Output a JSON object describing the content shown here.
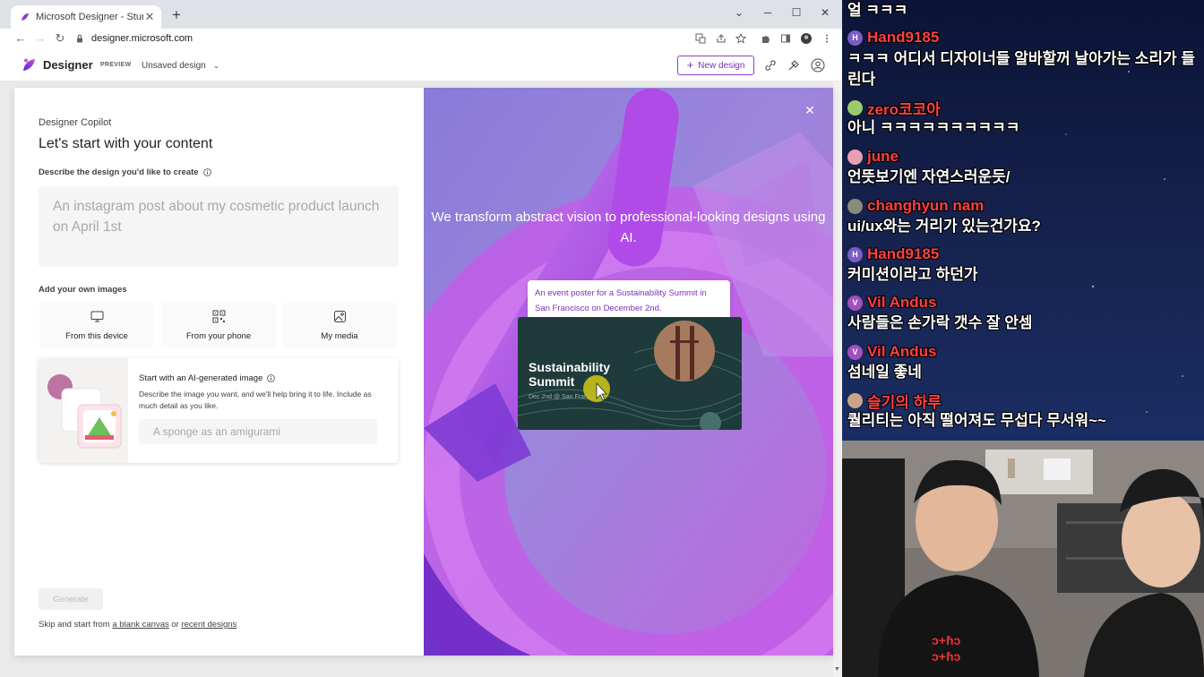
{
  "browser": {
    "tab_title": "Microsoft Designer - Stunning d",
    "tab_close": "✕",
    "new_tab": "+",
    "url": "designer.microsoft.com",
    "win_min": "─",
    "win_max": "☐",
    "win_close": "✕",
    "win_dropdown": "⌄"
  },
  "app": {
    "brand": "Designer",
    "badge": "PREVIEW",
    "doc_name": "Unsaved design",
    "new_design": "New design",
    "accent": "#7b2fb7"
  },
  "copilot": {
    "label": "Designer Copilot",
    "title": "Let's start with your content",
    "describe_label": "Describe the design you'd like to create",
    "prompt_placeholder": "An instagram post about my cosmetic product launch on April 1st",
    "images_label": "Add your own images",
    "sources": [
      "From this device",
      "From your phone",
      "My media"
    ],
    "ai_title": "Start with an AI-generated image",
    "ai_desc": "Describe the image you want, and we'll help bring it to life. Include as much detail as you like.",
    "ai_placeholder": "A sponge as an amigurami",
    "generate": "Generate",
    "skip_prefix": "Skip and start from",
    "blank_canvas": "a blank canvas",
    "or": "or",
    "recent_designs": "recent designs"
  },
  "showcase": {
    "close": "✕",
    "hero": "We transform abstract vision to professional-looking designs using AI.",
    "bubble": "An event poster for a Sustainability Summit in San Francisco on December 2nd.",
    "poster_title": "Sustainability Summit",
    "poster_sub": "Dec 2nd @ San Francisco"
  },
  "chat": {
    "messages": [
      {
        "user": "",
        "text": "얼 ㅋㅋㅋ",
        "avatar": "",
        "avatar_color": ""
      },
      {
        "user": "Hand9185",
        "text": "ㅋㅋㅋ 어디서 디자이너들 알바할꺼 날아가는 소리가 들린다",
        "avatar": "H",
        "avatar_color": "#7b5cc4"
      },
      {
        "user": "zero코코아",
        "text": "아니 ㅋㅋㅋㅋㅋㅋㅋㅋㅋㅋ",
        "avatar": "",
        "avatar_color": "#9acb6a"
      },
      {
        "user": "june",
        "text": "언뜻보기엔 자연스러운듯/",
        "avatar": "",
        "avatar_color": "#e8a0b0"
      },
      {
        "user": "changhyun nam",
        "text": "ui/ux와는 거리가 있는건가요?",
        "avatar": "",
        "avatar_color": "#8a8a7a"
      },
      {
        "user": "Hand9185",
        "text": "커미션이라고 하던가",
        "avatar": "H",
        "avatar_color": "#7b5cc4"
      },
      {
        "user": "Vil Andus",
        "text": "사람들은 손가락 갯수 잘 안셈",
        "avatar": "V",
        "avatar_color": "#a24fc0"
      },
      {
        "user": "Vil Andus",
        "text": "섬네일 좋네",
        "avatar": "V",
        "avatar_color": "#a24fc0"
      },
      {
        "user": "슬기의 하루",
        "text": "퀄리티는 아직 떨어져도 무섭다 무서워~~",
        "avatar": "",
        "avatar_color": "#c9a48a"
      }
    ]
  }
}
